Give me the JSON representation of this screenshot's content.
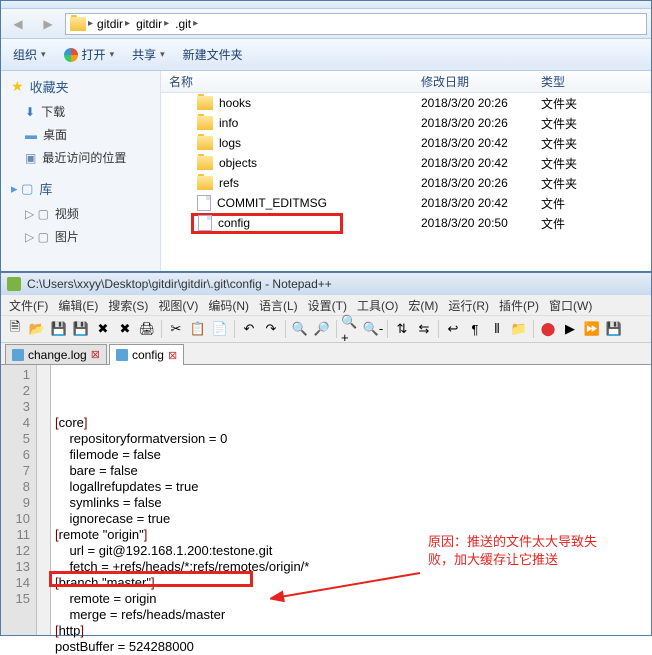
{
  "explorer": {
    "breadcrumbs": [
      "gitdir",
      "gitdir",
      ".git"
    ],
    "commands": {
      "organize": "组织",
      "open": "打开",
      "share": "共享",
      "newfolder": "新建文件夹"
    },
    "sidebar": {
      "favorites": {
        "title": "收藏夹",
        "items": [
          "下载",
          "桌面",
          "最近访问的位置"
        ]
      },
      "libraries": {
        "title": "库",
        "items": [
          "视频",
          "图片"
        ]
      }
    },
    "columns": {
      "name": "名称",
      "date": "修改日期",
      "type": "类型"
    },
    "files": [
      {
        "name": "hooks",
        "date": "2018/3/20 20:26",
        "type": "文件夹",
        "kind": "folder"
      },
      {
        "name": "info",
        "date": "2018/3/20 20:26",
        "type": "文件夹",
        "kind": "folder"
      },
      {
        "name": "logs",
        "date": "2018/3/20 20:42",
        "type": "文件夹",
        "kind": "folder"
      },
      {
        "name": "objects",
        "date": "2018/3/20 20:42",
        "type": "文件夹",
        "kind": "folder"
      },
      {
        "name": "refs",
        "date": "2018/3/20 20:26",
        "type": "文件夹",
        "kind": "folder"
      },
      {
        "name": "COMMIT_EDITMSG",
        "date": "2018/3/20 20:42",
        "type": "文件",
        "kind": "file"
      },
      {
        "name": "config",
        "date": "2018/3/20 20:50",
        "type": "文件",
        "kind": "file",
        "highlighted": true
      }
    ]
  },
  "npp": {
    "title": "C:\\Users\\xxyy\\Desktop\\gitdir\\gitdir\\.git\\config - Notepad++",
    "menus": [
      "文件(F)",
      "编辑(E)",
      "搜索(S)",
      "视图(V)",
      "编码(N)",
      "语言(L)",
      "设置(T)",
      "工具(O)",
      "宏(M)",
      "运行(R)",
      "插件(P)",
      "窗口(W)"
    ],
    "tabs": [
      {
        "label": "change.log",
        "active": false
      },
      {
        "label": "config",
        "active": true
      }
    ],
    "code": [
      "[core]",
      "    repositoryformatversion = 0",
      "    filemode = false",
      "    bare = false",
      "    logallrefupdates = true",
      "    symlinks = false",
      "    ignorecase = true",
      "[remote \"origin\"]",
      "    url = git@192.168.1.200:testone.git",
      "    fetch = +refs/heads/*:refs/remotes/origin/*",
      "[branch \"master\"]",
      "    remote = origin",
      "    merge = refs/heads/master",
      "[http]",
      "postBuffer = 524288000"
    ]
  },
  "annotation": {
    "line1": "原因：推送的文件太大导致失",
    "line2": "败，加大缓存让它推送"
  }
}
